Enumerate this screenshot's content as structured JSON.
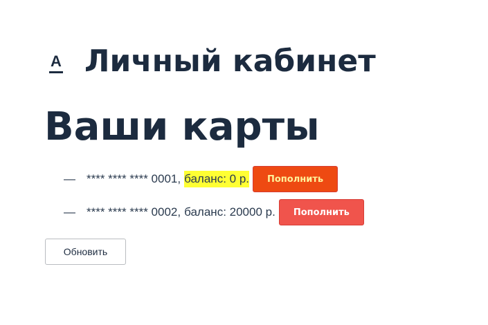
{
  "header": {
    "logo_letter": "А",
    "site_title": "Личный кабинет"
  },
  "page": {
    "heading": "Ваши карты"
  },
  "cards": [
    {
      "dash": "—",
      "number": "**** **** **** 0001",
      "separator": ",",
      "balance": "баланс: 0 р.",
      "topup_label": "Пополнить",
      "highlighted": true
    },
    {
      "dash": "—",
      "number": "**** **** **** 0002",
      "separator": ",",
      "balance": "баланс: 20000 р.",
      "topup_label": "Пополнить",
      "highlighted": false
    }
  ],
  "actions": {
    "refresh_label": "Обновить"
  },
  "colors": {
    "text": "#1c2b3f",
    "topup_button": "#f0544c",
    "topup_button_active": "#ee4a12",
    "highlight": "#ffff33"
  }
}
